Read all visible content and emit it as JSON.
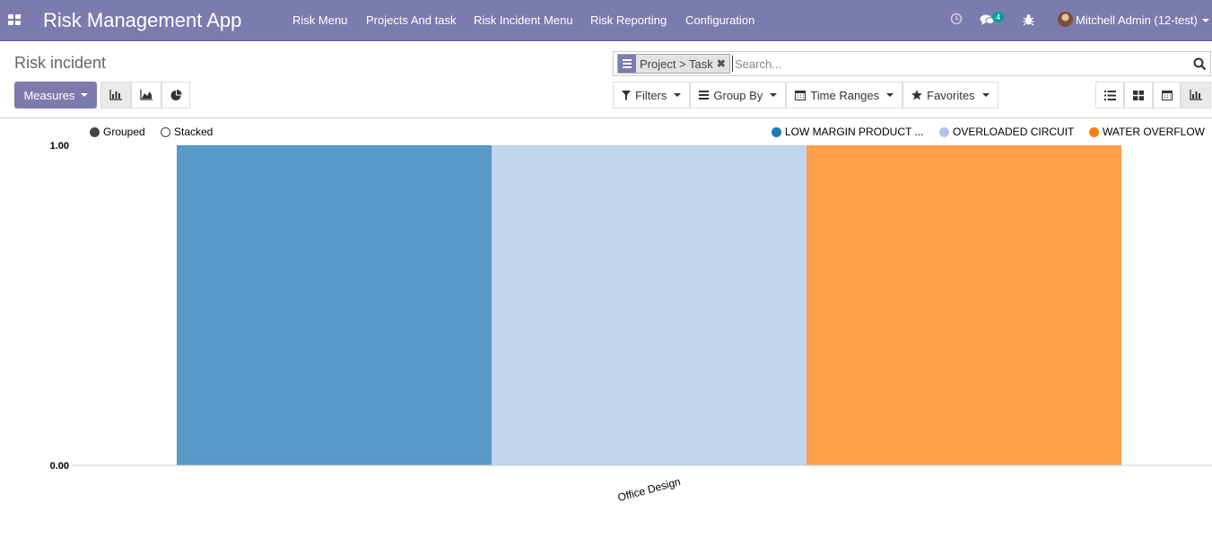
{
  "navbar": {
    "brand": "Risk Management App",
    "menu": [
      "Risk Menu",
      "Projects And task",
      "Risk Incident Menu",
      "Risk Reporting",
      "Configuration"
    ],
    "messages_count": "4",
    "user": "Mitchell Admin (12-test)"
  },
  "control_panel": {
    "breadcrumb": "Risk incident",
    "search": {
      "facet_label": "Project > Task",
      "placeholder": "Search..."
    },
    "measures_label": "Measures",
    "filters_label": "Filters",
    "group_by_label": "Group By",
    "time_ranges_label": "Time Ranges",
    "favorites_label": "Favorites"
  },
  "graph_modes": {
    "grouped_label": "Grouped",
    "stacked_label": "Stacked",
    "selected": "Grouped"
  },
  "colors": {
    "brand": "#7c7bad",
    "low_margin": "#1f77b4",
    "overloaded": "#aec7e8",
    "water_overflow": "#ff7f0e"
  },
  "chart_data": {
    "type": "bar",
    "categories": [
      "Office Design"
    ],
    "series": [
      {
        "name": "LOW MARGIN PRODUCT ...",
        "values": [
          1
        ],
        "color": "#1f77b4"
      },
      {
        "name": "OVERLOADED CIRCUIT",
        "values": [
          1
        ],
        "color": "#aec7e8"
      },
      {
        "name": "WATER OVERFLOW",
        "values": [
          1
        ],
        "color": "#ff7f0e"
      }
    ],
    "ylim": [
      0,
      1
    ],
    "y_ticks": [
      "0.00",
      "1.00"
    ],
    "legend_position": "top-right",
    "mode": "grouped"
  }
}
